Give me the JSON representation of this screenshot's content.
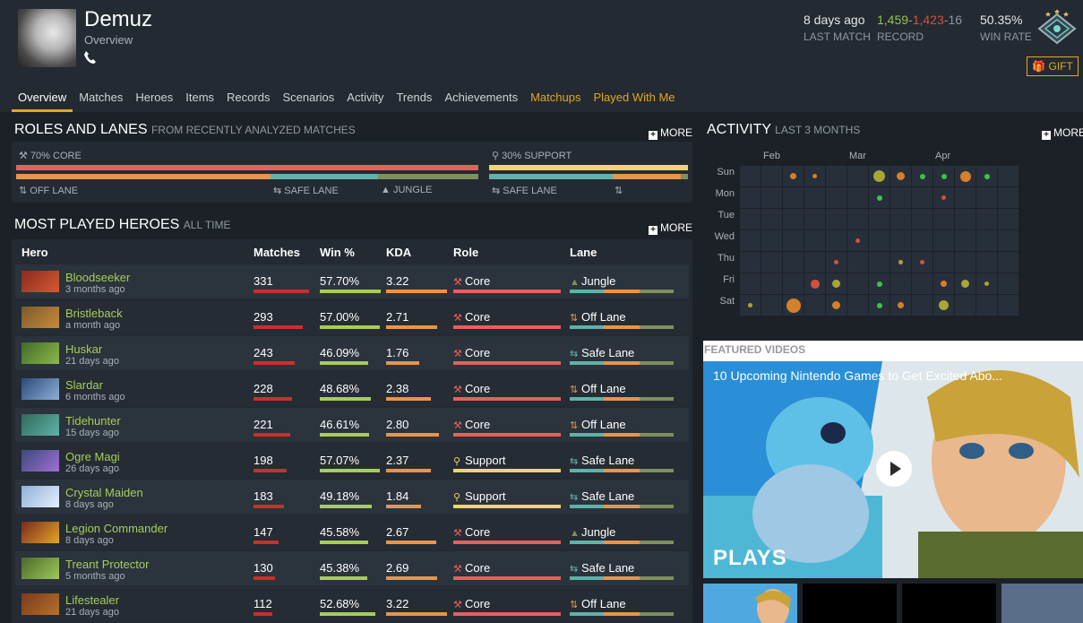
{
  "player": {
    "name": "Demuz",
    "subtitle": "Overview"
  },
  "stats": {
    "last_match": {
      "value": "8 days ago",
      "label": "LAST MATCH"
    },
    "record": {
      "wins": "1,459",
      "losses": "1,423",
      "abandons": "16",
      "label": "RECORD"
    },
    "win_rate": {
      "value": "50.35%",
      "label": "WIN RATE"
    }
  },
  "gift_label": "GIFT",
  "tabs": [
    {
      "label": "Overview",
      "active": true
    },
    {
      "label": "Matches"
    },
    {
      "label": "Heroes"
    },
    {
      "label": "Items"
    },
    {
      "label": "Records"
    },
    {
      "label": "Scenarios"
    },
    {
      "label": "Activity"
    },
    {
      "label": "Trends"
    },
    {
      "label": "Achievements"
    },
    {
      "label": "Matchups",
      "gold": true
    },
    {
      "label": "Played With Me",
      "gold": true
    }
  ],
  "roles": {
    "title": "ROLES AND LANES",
    "subtitle": "FROM RECENTLY ANALYZED MATCHES",
    "more": "MORE",
    "core": {
      "label": "70% CORE",
      "fraction": 0.7
    },
    "support": {
      "label": "30% SUPPORT",
      "fraction": 0.3
    },
    "lanes": {
      "off": "OFF LANE",
      "safe": "SAFE LANE",
      "jungle": "JUNGLE",
      "safe2": "SAFE LANE"
    }
  },
  "heroes": {
    "title": "MOST PLAYED HEROES",
    "subtitle": "ALL TIME",
    "more": "MORE",
    "columns": [
      "Hero",
      "Matches",
      "Win %",
      "KDA",
      "Role",
      "Lane"
    ],
    "rows": [
      {
        "name": "Bloodseeker",
        "time": "3 months ago",
        "matches": "331",
        "win": "57.70%",
        "kda": "3.22",
        "role": "Core",
        "lane": "Jungle"
      },
      {
        "name": "Bristleback",
        "time": "a month ago",
        "matches": "293",
        "win": "57.00%",
        "kda": "2.71",
        "role": "Core",
        "lane": "Off Lane"
      },
      {
        "name": "Huskar",
        "time": "21 days ago",
        "matches": "243",
        "win": "46.09%",
        "kda": "1.76",
        "role": "Core",
        "lane": "Safe Lane"
      },
      {
        "name": "Slardar",
        "time": "6 months ago",
        "matches": "228",
        "win": "48.68%",
        "kda": "2.38",
        "role": "Core",
        "lane": "Off Lane"
      },
      {
        "name": "Tidehunter",
        "time": "15 days ago",
        "matches": "221",
        "win": "46.61%",
        "kda": "2.80",
        "role": "Core",
        "lane": "Off Lane"
      },
      {
        "name": "Ogre Magi",
        "time": "26 days ago",
        "matches": "198",
        "win": "57.07%",
        "kda": "2.37",
        "role": "Support",
        "lane": "Safe Lane"
      },
      {
        "name": "Crystal Maiden",
        "time": "8 days ago",
        "matches": "183",
        "win": "49.18%",
        "kda": "1.84",
        "role": "Support",
        "lane": "Safe Lane"
      },
      {
        "name": "Legion Commander",
        "time": "8 days ago",
        "matches": "147",
        "win": "45.58%",
        "kda": "2.67",
        "role": "Core",
        "lane": "Jungle"
      },
      {
        "name": "Treant Protector",
        "time": "5 months ago",
        "matches": "130",
        "win": "45.38%",
        "kda": "2.69",
        "role": "Core",
        "lane": "Safe Lane"
      },
      {
        "name": "Lifestealer",
        "time": "21 days ago",
        "matches": "112",
        "win": "52.68%",
        "kda": "3.22",
        "role": "Core",
        "lane": "Off Lane"
      }
    ]
  },
  "activity": {
    "title": "ACTIVITY",
    "subtitle": "LAST 3 MONTHS",
    "more": "MORE",
    "months": [
      "Feb",
      "Mar",
      "Apr"
    ],
    "days": [
      "Sun",
      "Mon",
      "Tue",
      "Wed",
      "Thu",
      "Fri",
      "Sat"
    ]
  },
  "videos": {
    "header": "FEATURED VIDEOS",
    "title": "10 Upcoming Nintendo Games to Get Excited Abo...",
    "brand": "PLAYS"
  },
  "colors": {
    "accent": "#e3a624",
    "win": "#92c34a",
    "loss": "#d5503d",
    "core": "#e8605a",
    "support": "#f3d36b",
    "safe_lane": "#5fb3a8",
    "off_lane": "#e8954a",
    "jungle": "#7f8f5d"
  }
}
